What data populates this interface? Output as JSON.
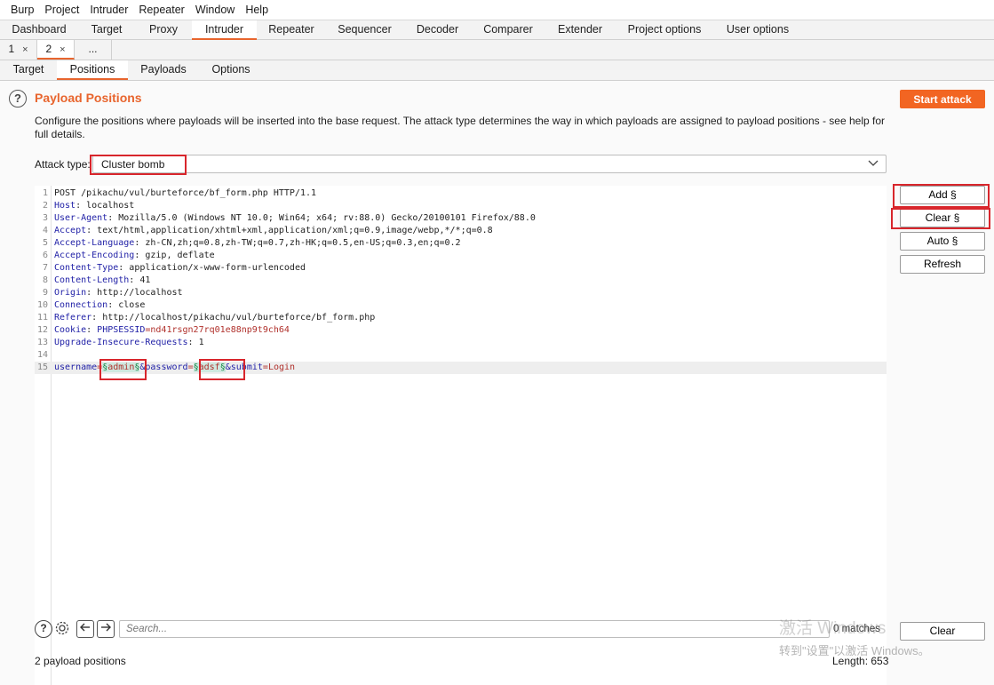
{
  "menubar": [
    "Burp",
    "Project",
    "Intruder",
    "Repeater",
    "Window",
    "Help"
  ],
  "main_tabs": [
    "Dashboard",
    "Target",
    "Proxy",
    "Intruder",
    "Repeater",
    "Sequencer",
    "Decoder",
    "Comparer",
    "Extender",
    "Project options",
    "User options"
  ],
  "active_main_tab": "Intruder",
  "request_tabs": [
    {
      "label": "1",
      "close": "×"
    },
    {
      "label": "2",
      "close": "×"
    },
    {
      "label": "..."
    }
  ],
  "intruder_tabs": [
    "Target",
    "Positions",
    "Payloads",
    "Options"
  ],
  "active_intruder_tab": "Positions",
  "help_icon": "?",
  "section_title": "Payload Positions",
  "start_attack_label": "Start attack",
  "description": "Configure the positions where payloads will be inserted into the base request. The attack type determines the way in which payloads are assigned to payload positions - see help for full details.",
  "attack_type_label": "Attack type:",
  "attack_type_value": "Cluster bomb",
  "side_buttons": {
    "add": "Add §",
    "clear": "Clear §",
    "auto": "Auto §",
    "refresh": "Refresh"
  },
  "request_lines": [
    {
      "n": "1",
      "text": "POST /pikachu/vul/burteforce/bf_form.php HTTP/1.1"
    },
    {
      "n": "2",
      "key": "Host",
      "val": " localhost"
    },
    {
      "n": "3",
      "key": "User-Agent",
      "val": " Mozilla/5.0 (Windows NT 10.0; Win64; x64; rv:88.0) Gecko/20100101 Firefox/88.0"
    },
    {
      "n": "4",
      "key": "Accept",
      "val": " text/html,application/xhtml+xml,application/xml;q=0.9,image/webp,*/*;q=0.8"
    },
    {
      "n": "5",
      "key": "Accept-Language",
      "val": " zh-CN,zh;q=0.8,zh-TW;q=0.7,zh-HK;q=0.5,en-US;q=0.3,en;q=0.2"
    },
    {
      "n": "6",
      "key": "Accept-Encoding",
      "val": " gzip, deflate"
    },
    {
      "n": "7",
      "key": "Content-Type",
      "val": " application/x-www-form-urlencoded"
    },
    {
      "n": "8",
      "key": "Content-Length",
      "val": " 41"
    },
    {
      "n": "9",
      "key": "Origin",
      "val": " http://localhost"
    },
    {
      "n": "10",
      "key": "Connection",
      "val": " close"
    },
    {
      "n": "11",
      "key": "Referer",
      "val": " http://localhost/pikachu/vul/burteforce/bf_form.php"
    },
    {
      "n": "12",
      "cookie_key": "PHPSESSID",
      "cookie_val": "nd41rsgn27rq01e88np9t9ch64"
    },
    {
      "n": "13",
      "key": "Upgrade-Insecure-Requests",
      "val": " 1"
    },
    {
      "n": "14",
      "text": ""
    },
    {
      "n": "15"
    }
  ],
  "cookie_label": "Cookie",
  "body_line": {
    "k1": "username",
    "v1": "admin",
    "k2": "&password",
    "v2": "adsf",
    "k3": "&submit",
    "v3": "Login",
    "marker": "§",
    "eq": "="
  },
  "search_placeholder": "Search...",
  "matches": "0 matches",
  "clear_label": "Clear",
  "status_positions": "2 payload positions",
  "status_length": "Length: 653",
  "watermark_line1": "激活 Windows",
  "watermark_line2": "转到\"设置\"以激活 Windows。",
  "colors": {
    "accent": "#e8652e",
    "start_attack": "#f26522",
    "highlight_box": "#d8262c"
  }
}
